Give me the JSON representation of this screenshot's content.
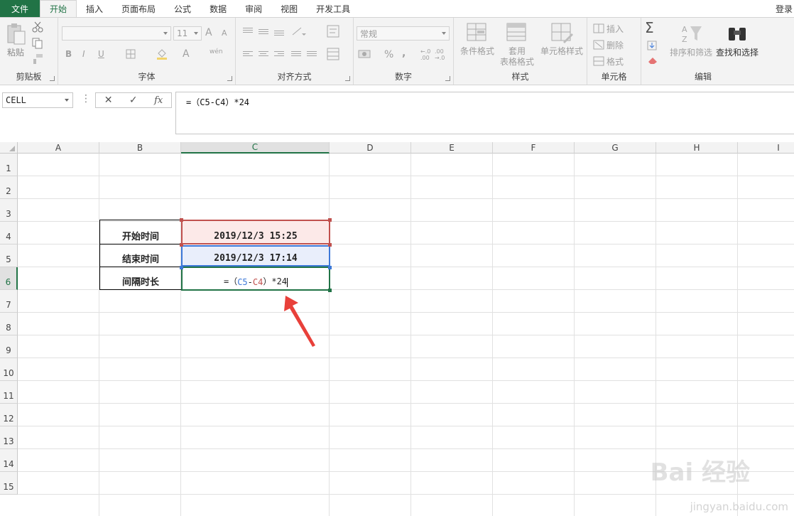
{
  "tabs": {
    "file": "文件",
    "items": [
      "开始",
      "插入",
      "页面布局",
      "公式",
      "数据",
      "审阅",
      "视图",
      "开发工具"
    ],
    "login": "登录"
  },
  "ribbon": {
    "clipboard": {
      "label": "剪贴板",
      "paste": "粘贴"
    },
    "font": {
      "label": "字体",
      "size": "11",
      "bold": "B",
      "italic": "I",
      "underline": "U",
      "grow": "A",
      "shrink": "A",
      "color": "A",
      "phonetic": "wén"
    },
    "alignment": {
      "label": "对齐方式"
    },
    "number": {
      "label": "数字",
      "format": "常规",
      "percent": "%",
      "comma": ",",
      "inc_decimal": "←.0 .00",
      "dec_decimal": ".00 →.0"
    },
    "styles": {
      "label": "样式",
      "conditional": "条件格式",
      "table_format_1": "套用",
      "table_format_2": "表格格式",
      "cell_styles": "单元格样式"
    },
    "cells": {
      "label": "单元格",
      "insert": "插入",
      "delete": "删除",
      "format": "格式"
    },
    "editing": {
      "label": "编辑",
      "sum": "Σ",
      "sort_filter": "排序和筛选",
      "find_select": "查找和选择"
    }
  },
  "formula_bar": {
    "name_box": "CELL",
    "formula": "=（C5-C4）*24"
  },
  "sheet": {
    "columns": [
      "A",
      "B",
      "C",
      "D",
      "E",
      "F",
      "G",
      "H",
      "I"
    ],
    "rows": [
      "1",
      "2",
      "3",
      "4",
      "5",
      "6",
      "7",
      "8",
      "9",
      "10",
      "11",
      "12",
      "13",
      "14",
      "15"
    ],
    "active_column": "C",
    "active_row": "6",
    "cells": {
      "B4": "开始时间",
      "B5": "结束时间",
      "B6": "间隔时长",
      "C4": "2019/12/3  15:25",
      "C5": "2019/12/3  17:14",
      "C6": {
        "prefix": "=（",
        "ref1": "C5",
        "minus": "-",
        "ref2": "C4",
        "suffix": "）*24"
      }
    },
    "colors": {
      "ref1": "#3c78d8",
      "ref2": "#c0504d",
      "active": "#217346",
      "arrow": "#e8403a"
    }
  },
  "watermark": {
    "logo": "Bai 经验",
    "url": "jingyan.baidu.com"
  }
}
